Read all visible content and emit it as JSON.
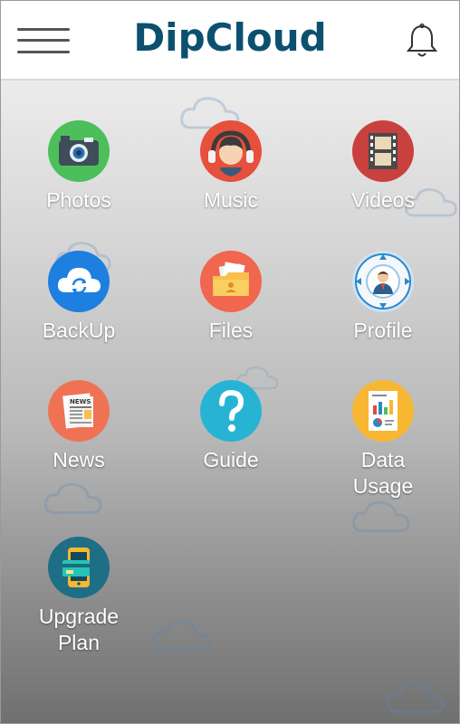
{
  "header": {
    "app_title": "DipCloud",
    "menu_icon": "hamburger-menu-icon",
    "notification_icon": "bell-icon"
  },
  "tiles": [
    {
      "label": "Photos",
      "icon": "camera-icon",
      "color": "#4cbf5a"
    },
    {
      "label": "Music",
      "icon": "headphones-person-icon",
      "color": "#e6503c"
    },
    {
      "label": "Videos",
      "icon": "film-reel-icon",
      "color": "#c9413e"
    },
    {
      "label": "BackUp",
      "icon": "cloud-sync-icon",
      "color": "#1d7fe0"
    },
    {
      "label": "Files",
      "icon": "folder-icon",
      "color": "#f0664f"
    },
    {
      "label": "Profile",
      "icon": "user-profile-icon",
      "color": "#cfe3f3"
    },
    {
      "label": "News",
      "icon": "newspaper-icon",
      "color": "#f07255"
    },
    {
      "label": "Guide",
      "icon": "question-mark-icon",
      "color": "#27b4d4"
    },
    {
      "label": "Data\nUsage",
      "icon": "report-chart-icon",
      "color": "#f7b733"
    },
    {
      "label": "Upgrade\nPlan",
      "icon": "phone-card-icon",
      "color": "#1e6f86"
    }
  ],
  "colors": {
    "brand": "#0c5070",
    "label_text": "#ffffff"
  }
}
